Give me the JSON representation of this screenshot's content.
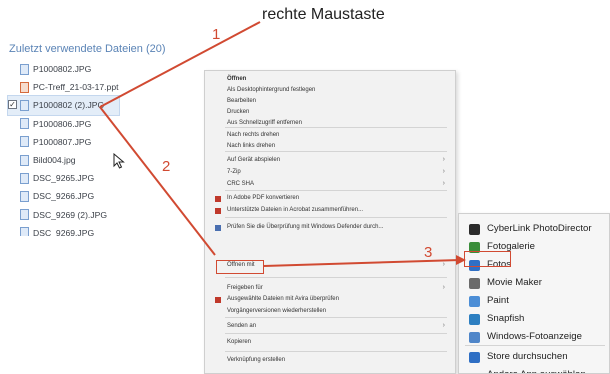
{
  "annotation": {
    "title": "rechte Maustaste",
    "step1": "1",
    "step2": "2",
    "step3": "3",
    "color": "#d14a32"
  },
  "recent_files": {
    "title": "Zuletzt verwendete Dateien (20)",
    "items": [
      {
        "name": "P1000802.JPG",
        "icon": "image-file-icon",
        "selected": false
      },
      {
        "name": "PC-Treff_21-03-17.ppt",
        "icon": "powerpoint-file-icon",
        "selected": false
      },
      {
        "name": "P1000802 (2).JPG",
        "icon": "image-file-icon",
        "selected": true
      },
      {
        "name": "P1000806.JPG",
        "icon": "image-file-icon",
        "selected": false
      },
      {
        "name": "P1000807.JPG",
        "icon": "image-file-icon",
        "selected": false
      },
      {
        "name": "Bild004.jpg",
        "icon": "image-file-icon",
        "selected": false
      },
      {
        "name": "DSC_9265.JPG",
        "icon": "image-file-icon",
        "selected": false
      },
      {
        "name": "DSC_9266.JPG",
        "icon": "image-file-icon",
        "selected": false
      },
      {
        "name": "DSC_9269 (2).JPG",
        "icon": "image-file-icon",
        "selected": false
      },
      {
        "name": "DSC_9269.JPG",
        "icon": "image-file-icon",
        "selected": false
      }
    ]
  },
  "context_menu": {
    "items": [
      {
        "label": "Öffnen",
        "bold": true,
        "arrow": false
      },
      {
        "label": "Als Desktophintergrund festlegen",
        "arrow": false
      },
      {
        "label": "Bearbeiten",
        "arrow": false
      },
      {
        "label": "Drucken",
        "arrow": false
      },
      {
        "label": "Aus Schnellzugriff entfernen",
        "arrow": false
      },
      {
        "sep": true
      },
      {
        "label": "Nach rechts drehen",
        "arrow": false
      },
      {
        "label": "Nach links drehen",
        "arrow": false
      },
      {
        "sep": true
      },
      {
        "label": "Auf Gerät abspielen",
        "arrow": true
      },
      {
        "label": "7-Zip",
        "arrow": true
      },
      {
        "label": "CRC SHA",
        "arrow": true
      },
      {
        "sep": true
      },
      {
        "label": "In Adobe PDF konvertieren",
        "arrow": false,
        "icon": "adobe-pdf-icon"
      },
      {
        "label": "Unterstützte Dateien in Acrobat zusammenführen...",
        "arrow": false,
        "icon": "acrobat-icon"
      },
      {
        "sep": true
      },
      {
        "label": "Prüfen Sie die Überprüfung mit Windows Defender durch...",
        "arrow": false,
        "icon": "defender-icon"
      },
      {
        "label": "Öffnen mit",
        "arrow": true,
        "highlight": true
      },
      {
        "sep": true
      },
      {
        "label": "Freigeben für",
        "arrow": true
      },
      {
        "label": "Ausgewählte Dateien mit Avira überprüfen",
        "arrow": false,
        "icon": "avira-icon"
      },
      {
        "label": "Vorgängerversionen wiederherstellen",
        "arrow": false
      },
      {
        "sep": true
      },
      {
        "label": "Senden an",
        "arrow": true
      },
      {
        "sep": true
      },
      {
        "label": "Kopieren",
        "arrow": false
      },
      {
        "sep": true
      },
      {
        "label": "Verknüpfung erstellen",
        "arrow": false
      }
    ]
  },
  "open_with": {
    "items": [
      {
        "label": "CyberLink PhotoDirector",
        "icon": "photodirector-icon",
        "color": "#2b2b2b"
      },
      {
        "label": "Fotogalerie",
        "icon": "photo-gallery-icon",
        "color": "#3a8d3a"
      },
      {
        "label": "Fotos",
        "icon": "photos-icon",
        "color": "#2f6fc4",
        "highlight": true
      },
      {
        "label": "Movie Maker",
        "icon": "movie-maker-icon",
        "color": "#6b6b6b"
      },
      {
        "label": "Paint",
        "icon": "paint-icon",
        "color": "#4c8ed6"
      },
      {
        "label": "Snapfish",
        "icon": "snapfish-icon",
        "color": "#2d7fc1"
      },
      {
        "label": "Windows-Fotoanzeige",
        "icon": "photo-viewer-icon",
        "color": "#4f86c9"
      },
      {
        "sep": true
      },
      {
        "label": "Store durchsuchen",
        "icon": "store-icon",
        "color": "#2f6fc4"
      },
      {
        "label": "Andere App auswählen",
        "icon": "",
        "color": ""
      }
    ]
  }
}
